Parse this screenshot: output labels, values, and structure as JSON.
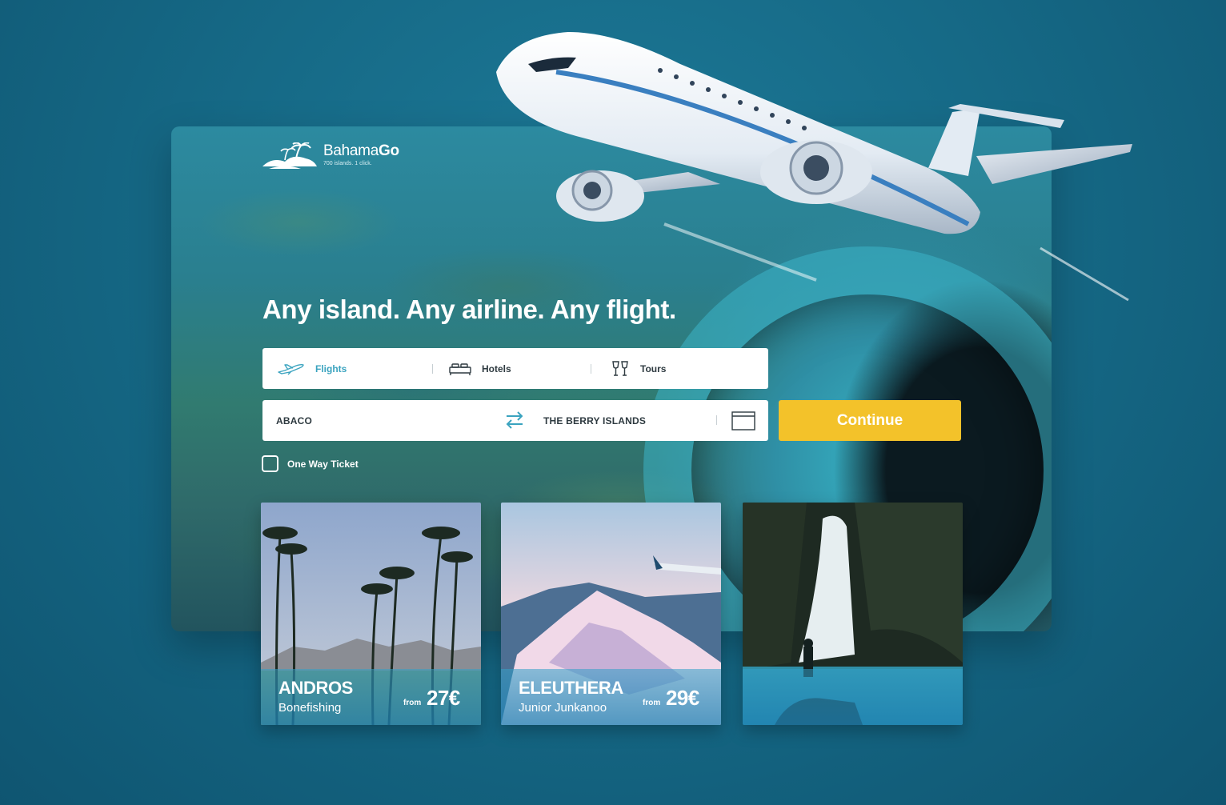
{
  "brand": {
    "name_light": "Bahama",
    "name_bold": "Go",
    "tagline": "700 islands. 1 click."
  },
  "headline": "Any island. Any airline. Any flight.",
  "tabs": [
    {
      "label": "Flights",
      "icon": "airplane-icon",
      "active": true
    },
    {
      "label": "Hotels",
      "icon": "bed-icon",
      "active": false
    },
    {
      "label": "Tours",
      "icon": "glasses-icon",
      "active": false
    }
  ],
  "search": {
    "from": "ABACO",
    "to": "THE BERRY ISLANDS",
    "swap_icon": "swap-arrows-icon",
    "calendar_icon": "calendar-icon",
    "continue_label": "Continue"
  },
  "one_way": {
    "label": "One Way Ticket",
    "checked": false
  },
  "cards": [
    {
      "name": "ANDROS",
      "subtitle": "Bonefishing",
      "from_label": "from",
      "price": "27€"
    },
    {
      "name": "ELEUTHERA",
      "subtitle": "Junior Junkanoo",
      "from_label": "from",
      "price": "29€"
    },
    {
      "name": "",
      "subtitle": "",
      "from_label": "",
      "price": ""
    }
  ],
  "colors": {
    "accent": "#3aa3bf",
    "button": "#f3c22a",
    "background": "#166a87"
  }
}
